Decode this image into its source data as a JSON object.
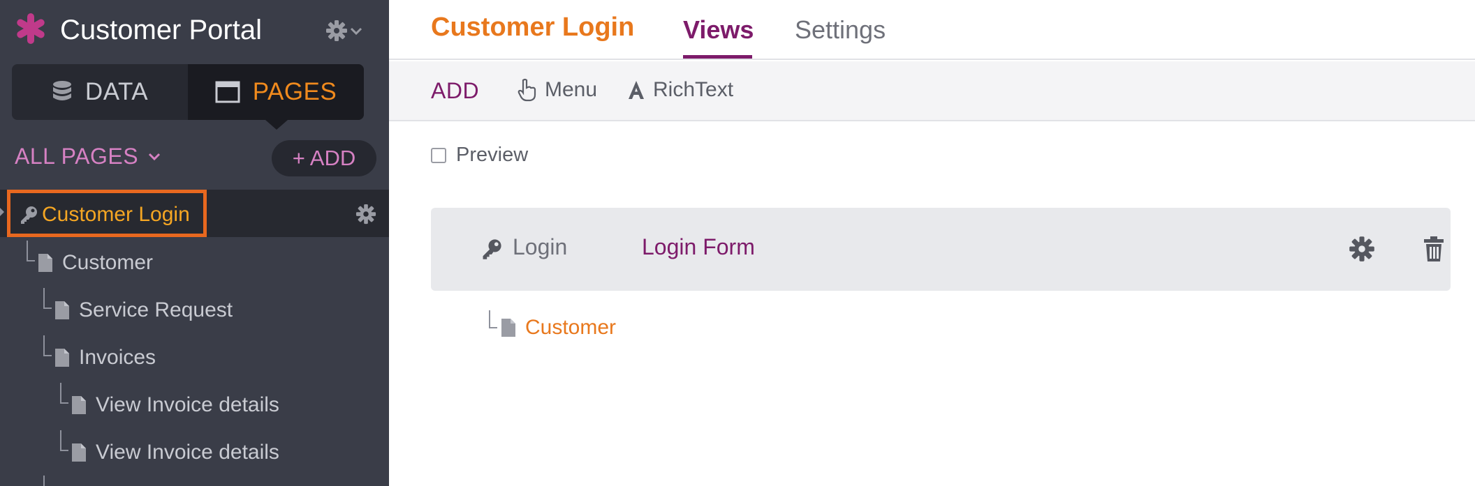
{
  "app": {
    "title": "Customer Portal",
    "brand_color": "#c03a8a"
  },
  "sidebar": {
    "switch": {
      "data_label": "DATA",
      "pages_label": "PAGES",
      "active": "PAGES"
    },
    "all_pages_label": "ALL PAGES",
    "add_label": "+ ADD",
    "tree": [
      {
        "label": "Customer Login",
        "icon": "key-icon",
        "selected": true
      },
      {
        "label": "Customer",
        "icon": "document-icon"
      },
      {
        "label": "Service Request",
        "icon": "document-icon"
      },
      {
        "label": "Invoices",
        "icon": "document-icon"
      },
      {
        "label": "View Invoice details",
        "icon": "document-icon"
      },
      {
        "label": "View Invoice details",
        "icon": "document-icon"
      }
    ]
  },
  "main": {
    "page_title": "Customer Login",
    "tabs": [
      {
        "label": "Views",
        "active": true
      },
      {
        "label": "Settings",
        "active": false
      }
    ],
    "toolbar": {
      "add_label": "ADD",
      "menu_label": "Menu",
      "richtext_label": "RichText"
    },
    "preview_label": "Preview",
    "preview_checked": false,
    "view": {
      "type_label": "Login",
      "name": "Login Form"
    },
    "child_page": {
      "label": "Customer",
      "icon": "document-icon"
    }
  },
  "colors": {
    "accent_orange": "#e8781d",
    "accent_purple": "#7d1b6a",
    "highlight_border": "#e8681f",
    "sidebar_bg": "#3a3d48"
  }
}
